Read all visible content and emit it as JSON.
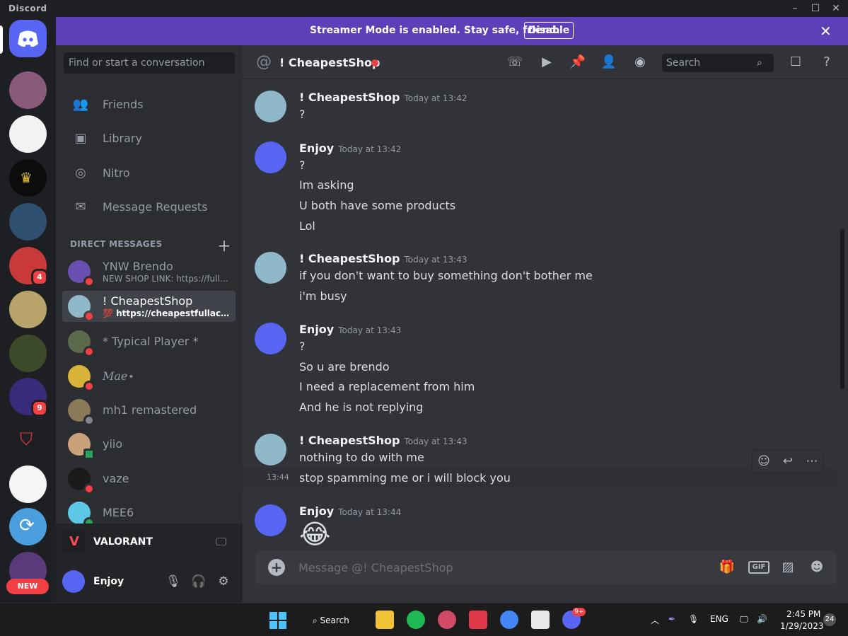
{
  "window": {
    "app_name": "Discord"
  },
  "colors": {
    "blurple": "#5865f2",
    "streamer": "#5d3fb8",
    "dnd_red": "#f23f43"
  },
  "streamer_banner": {
    "text": "Streamer Mode is enabled. Stay safe, friend.",
    "button": "Disable"
  },
  "guild_bar": {
    "badges": [
      "4",
      "9"
    ],
    "new_label": "NEW"
  },
  "dm_sidebar": {
    "search_placeholder": "Find or start a conversation",
    "nav": [
      {
        "label": "Friends",
        "icon": "friends-icon"
      },
      {
        "label": "Library",
        "icon": "library-icon"
      },
      {
        "label": "Nitro",
        "icon": "nitro-icon"
      },
      {
        "label": "Message Requests",
        "icon": "envelope-icon"
      }
    ],
    "section_title": "DIRECT MESSAGES",
    "dms": [
      {
        "name": "YNW Brendo",
        "sub": "NEW SHOP LINK: https://fulla..."
      },
      {
        "name": "! CheapestShop",
        "sub": "💯 https://cheapestfullacces..."
      },
      {
        "name": "* Typical Player *"
      },
      {
        "name": "𝑀𝑎𝑒⋆"
      },
      {
        "name": "mh1 remastered"
      },
      {
        "name": "yiio"
      },
      {
        "name": "vaze"
      },
      {
        "name": "MEE6"
      }
    ],
    "activity": {
      "game": "VALORANT"
    },
    "user": {
      "name": "Enjoy"
    }
  },
  "chat": {
    "title": "! CheapestShop",
    "search_placeholder": "Search",
    "messages": [
      {
        "author": "! CheapestShop",
        "time": "Today at 13:42",
        "lines": [
          "?"
        ]
      },
      {
        "author": "Enjoy",
        "time": "Today at 13:42",
        "lines": [
          "?",
          "Im asking",
          "U both have some products",
          "Lol"
        ]
      },
      {
        "author": "! CheapestShop",
        "time": "Today at 13:43",
        "lines": [
          "if you don't want to buy something don't bother me",
          "i'm busy"
        ]
      },
      {
        "author": "Enjoy",
        "time": "Today at 13:43",
        "lines": [
          "?",
          "So u are brendo",
          "I need a replacement from him",
          "And he is not replying"
        ]
      },
      {
        "author": "! CheapestShop",
        "time": "Today at 13:43",
        "lines": [
          "nothing to do with me",
          "stop spamming me or i will block you"
        ],
        "hover_stamp": "13:44"
      },
      {
        "author": "Enjoy",
        "time": "Today at 13:44",
        "lines": [
          "😂"
        ]
      }
    ],
    "composer_placeholder": "Message @! CheapestShop",
    "gif_label": "GIF"
  },
  "taskbar": {
    "search_label": "Search",
    "discord_badge": "9+",
    "language": "ENG",
    "time": "2:45 PM",
    "date": "1/29/2023",
    "notification_count": "24"
  }
}
